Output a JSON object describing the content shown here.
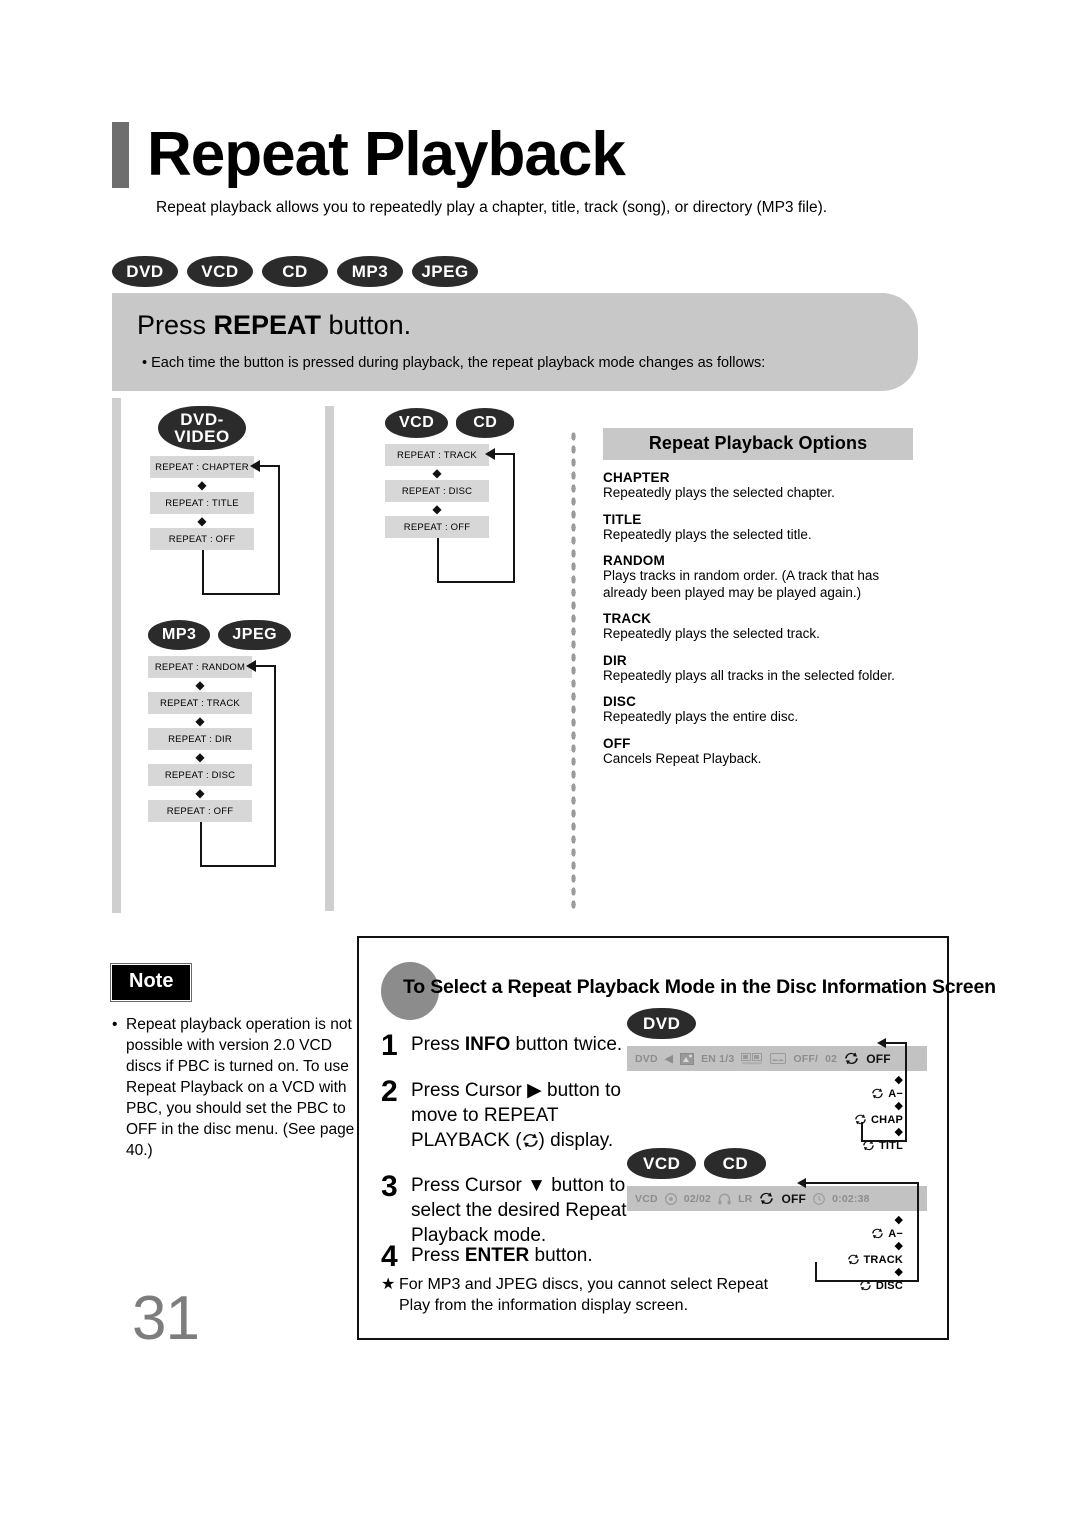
{
  "header": {
    "title": "Repeat Playback",
    "subtitle": "Repeat playback allows you to repeatedly play a chapter, title, track (song), or directory (MP3 file).",
    "disc_pills": [
      "DVD",
      "VCD",
      "CD",
      "MP3",
      "JPEG"
    ]
  },
  "banner": {
    "heading_pre": "Press ",
    "heading_bold": "REPEAT",
    "heading_post": " button.",
    "bullet": "• Each time the button is pressed during playback, the repeat playback mode changes as follows:"
  },
  "flows": [
    {
      "id": "dvd-video",
      "pills": [
        "DVD-",
        "VIDEO"
      ],
      "steps": [
        "REPEAT : CHAPTER",
        "REPEAT : TITLE",
        "REPEAT : OFF"
      ]
    },
    {
      "id": "mp3-jpeg",
      "pills": [
        "MP3",
        "JPEG"
      ],
      "steps": [
        "REPEAT : RANDOM",
        "REPEAT : TRACK",
        "REPEAT : DIR",
        "REPEAT : DISC",
        "REPEAT : OFF"
      ]
    },
    {
      "id": "vcd-cd",
      "pills": [
        "VCD",
        "CD"
      ],
      "steps": [
        "REPEAT : TRACK",
        "REPEAT : DISC",
        "REPEAT : OFF"
      ]
    }
  ],
  "options": {
    "title": "Repeat Playback Options",
    "items": [
      {
        "name": "CHAPTER",
        "desc": "Repeatedly plays the selected chapter."
      },
      {
        "name": "TITLE",
        "desc": "Repeatedly plays the selected title."
      },
      {
        "name": "RANDOM",
        "desc": "Plays tracks in random order.\n(A track that has already been played may be played again.)"
      },
      {
        "name": "TRACK",
        "desc": "Repeatedly plays the selected track."
      },
      {
        "name": "DIR",
        "desc": "Repeatedly plays all tracks in the selected folder."
      },
      {
        "name": "DISC",
        "desc": "Repeatedly plays the entire disc."
      },
      {
        "name": "OFF",
        "desc": "Cancels Repeat Playback."
      }
    ]
  },
  "note": {
    "badge": "Note",
    "bullet": "•",
    "text": "Repeat playback operation is not possible with version 2.0 VCD discs if PBC is turned on. To use Repeat Playback on a VCD with PBC, you should set the PBC to OFF in the disc menu. (See page 40.)"
  },
  "page_number": "31",
  "bottom": {
    "heading": "To Select a Repeat Playback Mode in the Disc Information Screen",
    "steps": [
      {
        "num": "1",
        "pre": "Press ",
        "bold": "INFO",
        "post": " button twice."
      },
      {
        "num": "2",
        "pre": "Press Cursor ▶ button to move to REPEAT PLAYBACK (",
        "bold": "",
        "post": ") display."
      },
      {
        "num": "3",
        "pre": "Press Cursor ▼ button to select the desired Repeat Playback mode.",
        "bold": "",
        "post": ""
      },
      {
        "num": "4",
        "pre": "Press ",
        "bold": "ENTER",
        "post": " button."
      }
    ],
    "footnote_star": "★",
    "footnote": "For MP3 and JPEG discs, you cannot select Repeat Play from the information display screen.",
    "osd": [
      {
        "id": "dvd-osd",
        "pills": [
          "DVD"
        ],
        "bar": {
          "label": "DVD",
          "cursor": "◀",
          "audio_lang": "EN 1/3",
          "subtitle": "OFF/",
          "angle": "02",
          "repeat_value": "OFF"
        },
        "chain": [
          "A−",
          "CHAP",
          "TITL"
        ]
      },
      {
        "id": "vcd-cd-osd",
        "pills": [
          "VCD",
          "CD"
        ],
        "bar": {
          "label": "VCD",
          "track": "02/02",
          "audio": "LR",
          "repeat_value": "OFF",
          "time": "0:02:38"
        },
        "chain": [
          "A−",
          "TRACK",
          "DISC"
        ]
      }
    ]
  },
  "colors": {
    "pill_bg": "#2b2b2b",
    "banner_bg": "#c8c8c8",
    "flowbox_bg": "#d7d7d7",
    "rule": "#cfcfcf",
    "page_number": "#7d7d7d",
    "osd_bar": "#c2c2c2"
  }
}
